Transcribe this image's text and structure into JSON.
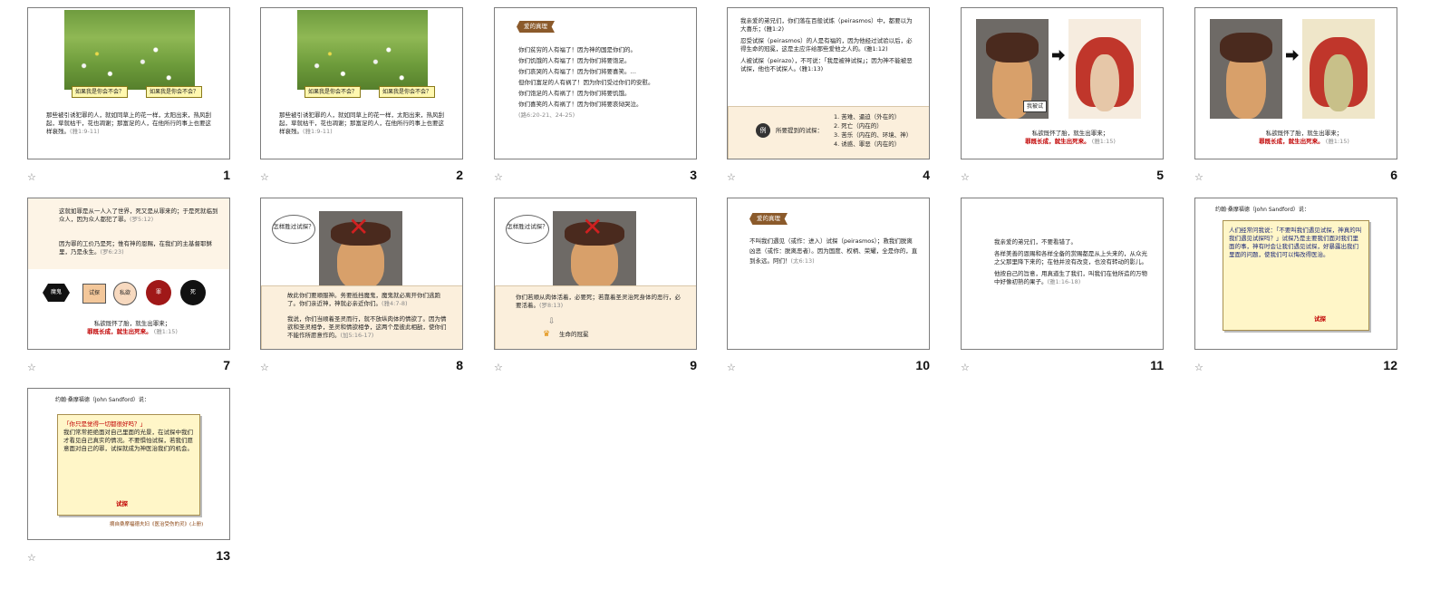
{
  "slides": [
    {
      "num": "1",
      "callouts": [
        "如果我是你会不会？",
        "如果我是你会不会？"
      ],
      "text": "那些被引诱犯罪的人，就如同草上的花一样，太阳出来，热风刮起，草就枯干，花也凋谢；那富足的人，在他所行的事上也要这样衰残。",
      "ref": "(雅1:9-11)"
    },
    {
      "num": "2",
      "callouts": [
        "如果我是你会不会？",
        "如果我是你会不会？"
      ],
      "text": "那些被引诱犯罪的人，就如同草上的花一样，太阳出来，热风刮起，草就枯干，花也凋谢；那富足的人，在他所行的事上也要这样衰残。",
      "ref": "(雅1:9-11)"
    },
    {
      "num": "3",
      "tag": "爱的真理",
      "lines": [
        "你们贫穷的人有福了！因为神的国是你们的。",
        "你们饥饿的人有福了！因为你们将要饱足。",
        "你们哀哭的人有福了！因为你们将要喜笑。…",
        "但你们富足的人有祸了！因为你们受过你们的安慰。",
        "你们饱足的人有祸了！因为你们将要饥饿。",
        "你们喜笑的人有祸了！因为你们将要哀恸哭泣。"
      ],
      "ref": "(路6:20-21、24-25)"
    },
    {
      "num": "4",
      "lines": [
        "我亲爱的弟兄们，你们落在百般试炼（peirasmos）中，都要以为大喜乐；(雅1:2)",
        "忍受试探（peirasmos）的人是有福的，因为他经过试验以后，必得生命的冠冕，这是主应许给那些爱他之人的。(雅1:12)",
        "人被试探（peirazo），不可说：「我是被神试探」；因为神不能被恶试探，他也不试探人。(雅1:13)"
      ],
      "box_label": "所要提到的试探：",
      "box_items": [
        "1. 苦难、逼迫（外在的）",
        "2. 死亡（内在的）",
        "3. 苦乐（内在的、环境、神）",
        "4. 诱惑、罪恶（内在的）"
      ]
    },
    {
      "num": "5",
      "bubble": "我被试",
      "caption_1": "私欲既怀了胎，就生出罪来；",
      "caption_2": "罪既长成，就生出死来。",
      "ref": "(雅1:15)"
    },
    {
      "num": "6",
      "caption_1": "私欲既怀了胎，就生出罪来；",
      "caption_2": "罪既长成，就生出死来。",
      "ref": "(雅1:15)"
    },
    {
      "num": "7",
      "text_a": "这就如罪是从一人入了世界，死又是从罪来的；于是死就临到众人，因为众人都犯了罪。",
      "ref_a": "(罗5:12)",
      "text_b": "因为罪的工价乃是死；惟有神的恩赐，在我们的主基督耶稣里，乃是永生。",
      "ref_b": "(罗6:23)",
      "chain": [
        "魔鬼",
        "试探",
        "私欲",
        "罪",
        "死"
      ],
      "caption_1": "私欲既怀了胎，就生出罪来；",
      "caption_2": "罪既长成，就生出死来。",
      "ref": "(雅1:15)"
    },
    {
      "num": "8",
      "thought": "怎样胜过试探？",
      "text_a": "故此你们要顺服神。务要抵挡魔鬼，魔鬼就必离开你们逃跑了。你们亲近神，神就必亲近你们。",
      "ref_a": "(雅4:7-8)",
      "text_b": "我说，你们当顺着圣灵而行，就不放纵肉体的情欲了。因为情欲和圣灵相争，圣灵和情欲相争，这两个是彼此相敌，使你们不能作所愿意作的。",
      "ref_b": "(加5:16-17)"
    },
    {
      "num": "9",
      "thought": "怎样胜过试探？",
      "text_a": "你们若顺从肉体活着，必要死；若靠着圣灵治死身体的恶行，必要活着。",
      "ref_a": "(罗8:13)",
      "crown_label": "生命的冠冕"
    },
    {
      "num": "10",
      "tag": "爱的真理",
      "text": "不叫我们遇见（或作：进入）试探（peirasmos）；救我们脱离凶恶（或作：脱离恶者）。因为国度、权柄、荣耀，全是你的，直到永远。阿们！",
      "ref": "(太6:13)"
    },
    {
      "num": "11",
      "text_a": "我亲爱的弟兄们，不要看错了。",
      "text_b": "各样美善的恩赐和各样全备的赏赐都是从上头来的，从众光之父那里降下来的；在他并没有改变，也没有转动的影儿。",
      "text_c": "他按自己的旨意，用真道生了我们，叫我们在他所造的万物中好像初熟的果子。",
      "ref": "(雅1:16-18)"
    },
    {
      "num": "12",
      "header": "约翰·桑摩福德（John Sandford）说：",
      "note": "人们经常问我说：「不要叫我们遇见试探，神真的叫我们遇见试探吗？」试探乃是主要我们面对我们里面的事，神有时会让我们遇见试探，好暴露出我们里面的问题，使我们可以悔改得医治。",
      "note_red": "试探"
    },
    {
      "num": "13",
      "header": "约翰·桑摩福德（John Sandford）说：",
      "note_q": "「你只是觉得一切都很好吗？」",
      "note": "我们常常拒绝面对自己里面的光景，在试探中我们才看见自己真实的情况。不要惧怕试探，若我们愿意面对自己的罪，试探就成为神医治我们的机会。",
      "note_red": "试探",
      "footer": "摘自桑摩福德夫妇《医治受伤的灵》(上册)"
    }
  ]
}
